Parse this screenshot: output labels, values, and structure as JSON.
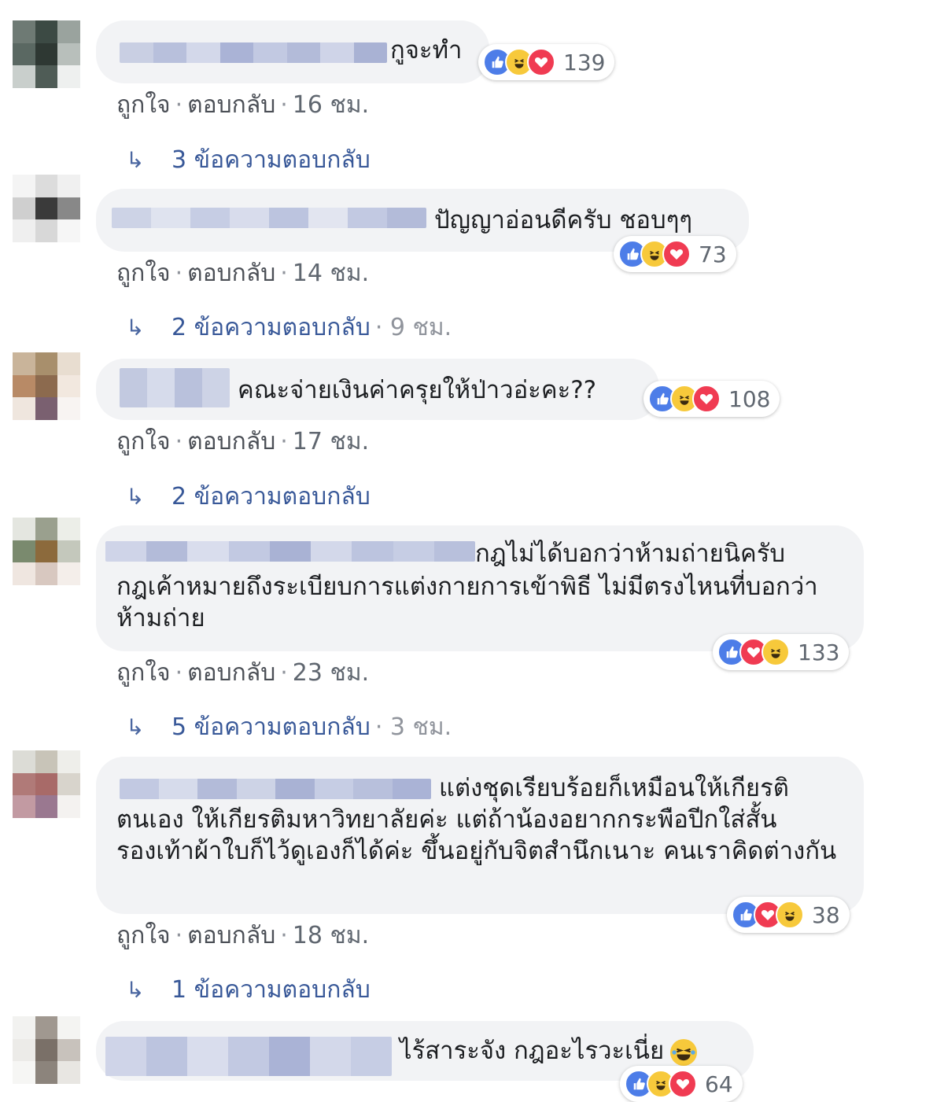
{
  "labels": {
    "like": "ถูกใจ",
    "reply": "ตอบกลับ",
    "dot": "·"
  },
  "colors": {
    "bubble": "#f2f3f5",
    "link": "#385898",
    "like": "#4d7de8",
    "haha": "#f7c93b",
    "love": "#f03b52"
  },
  "comments": [
    {
      "text": "กูจะทำ",
      "reaction_count": "139",
      "reaction_icons": [
        "like-icon",
        "haha-icon",
        "love-icon"
      ],
      "time": "16 ชม.",
      "replies_label": "3 ข้อความตอบกลับ",
      "replies_time": ""
    },
    {
      "text": "ปัญญาอ่อนดีครับ ชอบๆๆ",
      "reaction_count": "73",
      "reaction_icons": [
        "like-icon",
        "haha-icon",
        "love-icon"
      ],
      "time": "14 ชม.",
      "replies_label": "2 ข้อความตอบกลับ",
      "replies_time": "9 ชม."
    },
    {
      "text": "คณะจ่ายเงินค่าครุยให้ป่าวอ่ะคะ??",
      "reaction_count": "108",
      "reaction_icons": [
        "like-icon",
        "haha-icon",
        "love-icon"
      ],
      "time": "17 ชม.",
      "replies_label": "2 ข้อความตอบกลับ",
      "replies_time": ""
    },
    {
      "text_line1": "กฎไม่ได้บอกว่าห้ามถ่ายนิครับ",
      "text_rest": "กฎเค้าหมายถึงระเบียบการแต่งกายการเข้าพิธี ไม่มีตรงไหนที่บอกว่าห้ามถ่าย",
      "reaction_count": "133",
      "reaction_icons": [
        "like-icon",
        "love-icon",
        "haha-icon"
      ],
      "time": "23 ชม.",
      "replies_label": "5 ข้อความตอบกลับ",
      "replies_time": "3 ชม."
    },
    {
      "text_line1": "แต่งชุดเรียบร้อยก็เหมือนให้เกียรติ",
      "text_rest": "ตนเอง ให้เกียรติมหาวิทยาลัยค่ะ แต่ถ้าน้องอยากกระพือปีกใส่สั้นรองเท้าผ้าใบก็ไว้ดูเองก็ได้ค่ะ ขึ้นอยู่กับจิตสำนึกเนาะ คนเราคิดต่างกัน",
      "reaction_count": "38",
      "reaction_icons": [
        "like-icon",
        "love-icon",
        "haha-icon"
      ],
      "time": "18 ชม.",
      "replies_label": "1 ข้อความตอบกลับ",
      "replies_time": ""
    },
    {
      "text": "ไร้สาระจัง กฎอะไรวะเนี่ย",
      "reaction_count": "64",
      "reaction_icons": [
        "like-icon",
        "haha-icon",
        "love-icon"
      ],
      "time": "",
      "replies_label": "",
      "replies_time": ""
    }
  ]
}
